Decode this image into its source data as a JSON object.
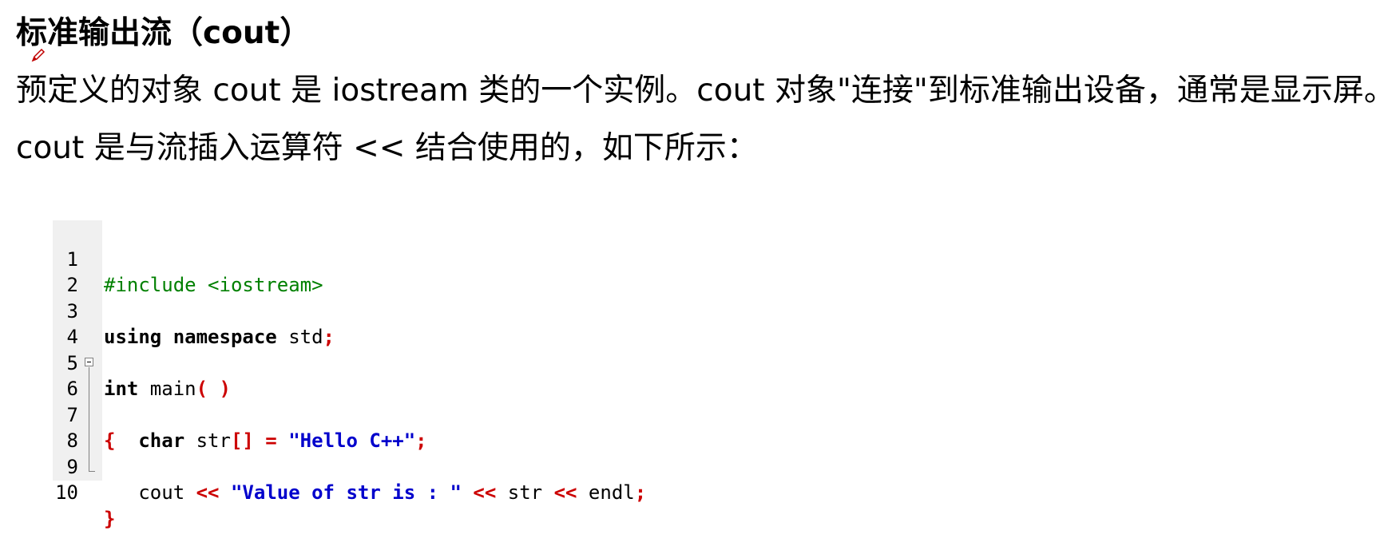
{
  "heading": {
    "title": "标准输出流（cout）"
  },
  "paragraphs": [
    "预定义的对象 cout 是 iostream 类的一个实例。cout 对象\"连接\"到标准输出设备，通常是显示屏。",
    "cout 是与流插入运算符 << 结合使用的，如下所示："
  ],
  "code": {
    "line_numbers": [
      "1",
      "2",
      "3",
      "4",
      "5",
      "6",
      "7",
      "8",
      "9",
      "10"
    ],
    "l1": {
      "include": "#include <iostream>"
    },
    "l3": {
      "using": "using",
      "namespace": "namespace",
      "std": " std",
      "semi": ";"
    },
    "l5": {
      "int": "int",
      "main": " main",
      "parens": "( )"
    },
    "l6": {
      "brace": "{"
    },
    "l7": {
      "indent": "   ",
      "char": "char",
      "str": " str",
      "brackets": "[]",
      "assign": " = ",
      "literal": "\"Hello C++\"",
      "semi": ";"
    },
    "l9": {
      "indent": "   ",
      "cout": "cout ",
      "op1": "<<",
      "literal": " \"Value of str is : \" ",
      "op2": "<<",
      "str": " str ",
      "op3": "<<",
      "endl": " endl",
      "semi": ";"
    },
    "l10": {
      "brace": "}"
    }
  },
  "icons": [
    "pen-icon",
    "fold-toggle-icon"
  ],
  "colors": {
    "preprocessor": "#008000",
    "operator": "#cc0000",
    "string": "#0000cc",
    "gutter": "#f0f0f0"
  }
}
